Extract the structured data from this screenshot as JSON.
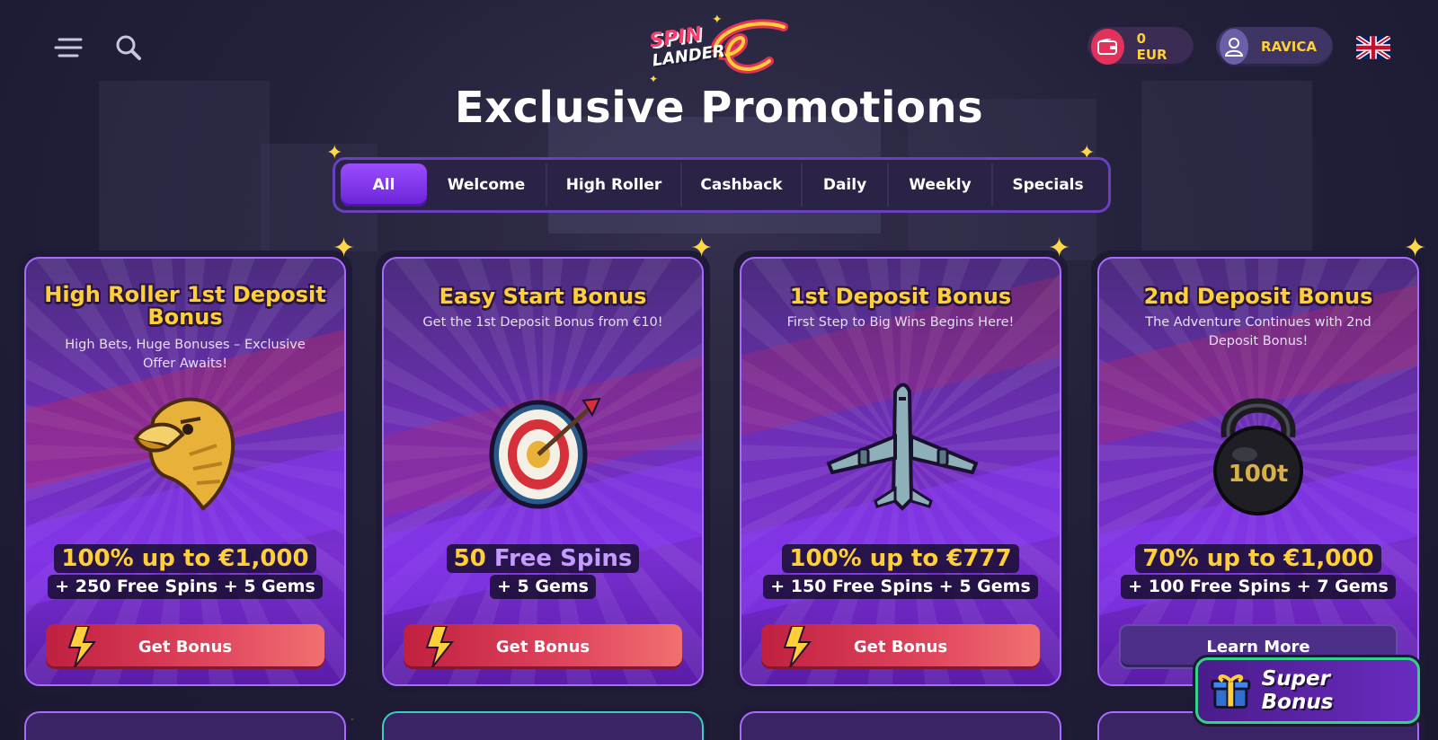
{
  "header": {
    "logo_line1": "SPIN",
    "logo_line2": "LANDER",
    "wallet_label": "0 EUR",
    "username": "RAVICA",
    "menu_icon": "menu-icon",
    "search_icon": "search-icon",
    "language_flag": "uk-flag-icon"
  },
  "page": {
    "title": "Exclusive Promotions"
  },
  "tabs": [
    {
      "label": "All",
      "active": true
    },
    {
      "label": "Welcome",
      "active": false
    },
    {
      "label": "High Roller",
      "active": false
    },
    {
      "label": "Cashback",
      "active": false
    },
    {
      "label": "Daily",
      "active": false
    },
    {
      "label": "Weekly",
      "active": false
    },
    {
      "label": "Specials",
      "active": false
    }
  ],
  "promotions": [
    {
      "title": "High Roller 1st Deposit Bonus",
      "subtitle": "High Bets, Huge Bonuses – Exclusive Offer Awaits!",
      "art": "eagle-icon",
      "offer_pre": "100% up to ",
      "offer_amount": "€1,000",
      "offer_extra": "+ 250 Free Spins + 5 Gems",
      "cta": "Get Bonus"
    },
    {
      "title": "Easy Start Bonus",
      "subtitle": "Get the 1st Deposit Bonus from €10!",
      "art": "target-icon",
      "offer_pre": "50 ",
      "offer_amount": "Free Spins",
      "offer_extra": "+ 5 Gems",
      "cta": "Get Bonus"
    },
    {
      "title": "1st Deposit Bonus",
      "subtitle": "First Step to Big Wins Begins Here!",
      "art": "airplane-icon",
      "offer_pre": "100% up to ",
      "offer_amount": "€777",
      "offer_extra": "+ 150 Free Spins + 5 Gems",
      "cta": "Get Bonus"
    },
    {
      "title": "2nd Deposit Bonus",
      "subtitle": "The Adventure Continues with 2nd Deposit Bonus!",
      "art": "kettlebell-icon",
      "art_text": "100t",
      "offer_pre": "70% up to ",
      "offer_amount": "€1,000",
      "offer_extra": "+ 100 Free Spins + 7 Gems",
      "cta": "Learn More"
    }
  ],
  "super_bonus": {
    "label": "Super Bonus",
    "icon": "gift-box-icon"
  },
  "colors": {
    "accent_purple": "#9b4dff",
    "gold": "#ffcf3a",
    "cta_red": "#d9344f",
    "super_bonus_border": "#35d08a"
  }
}
